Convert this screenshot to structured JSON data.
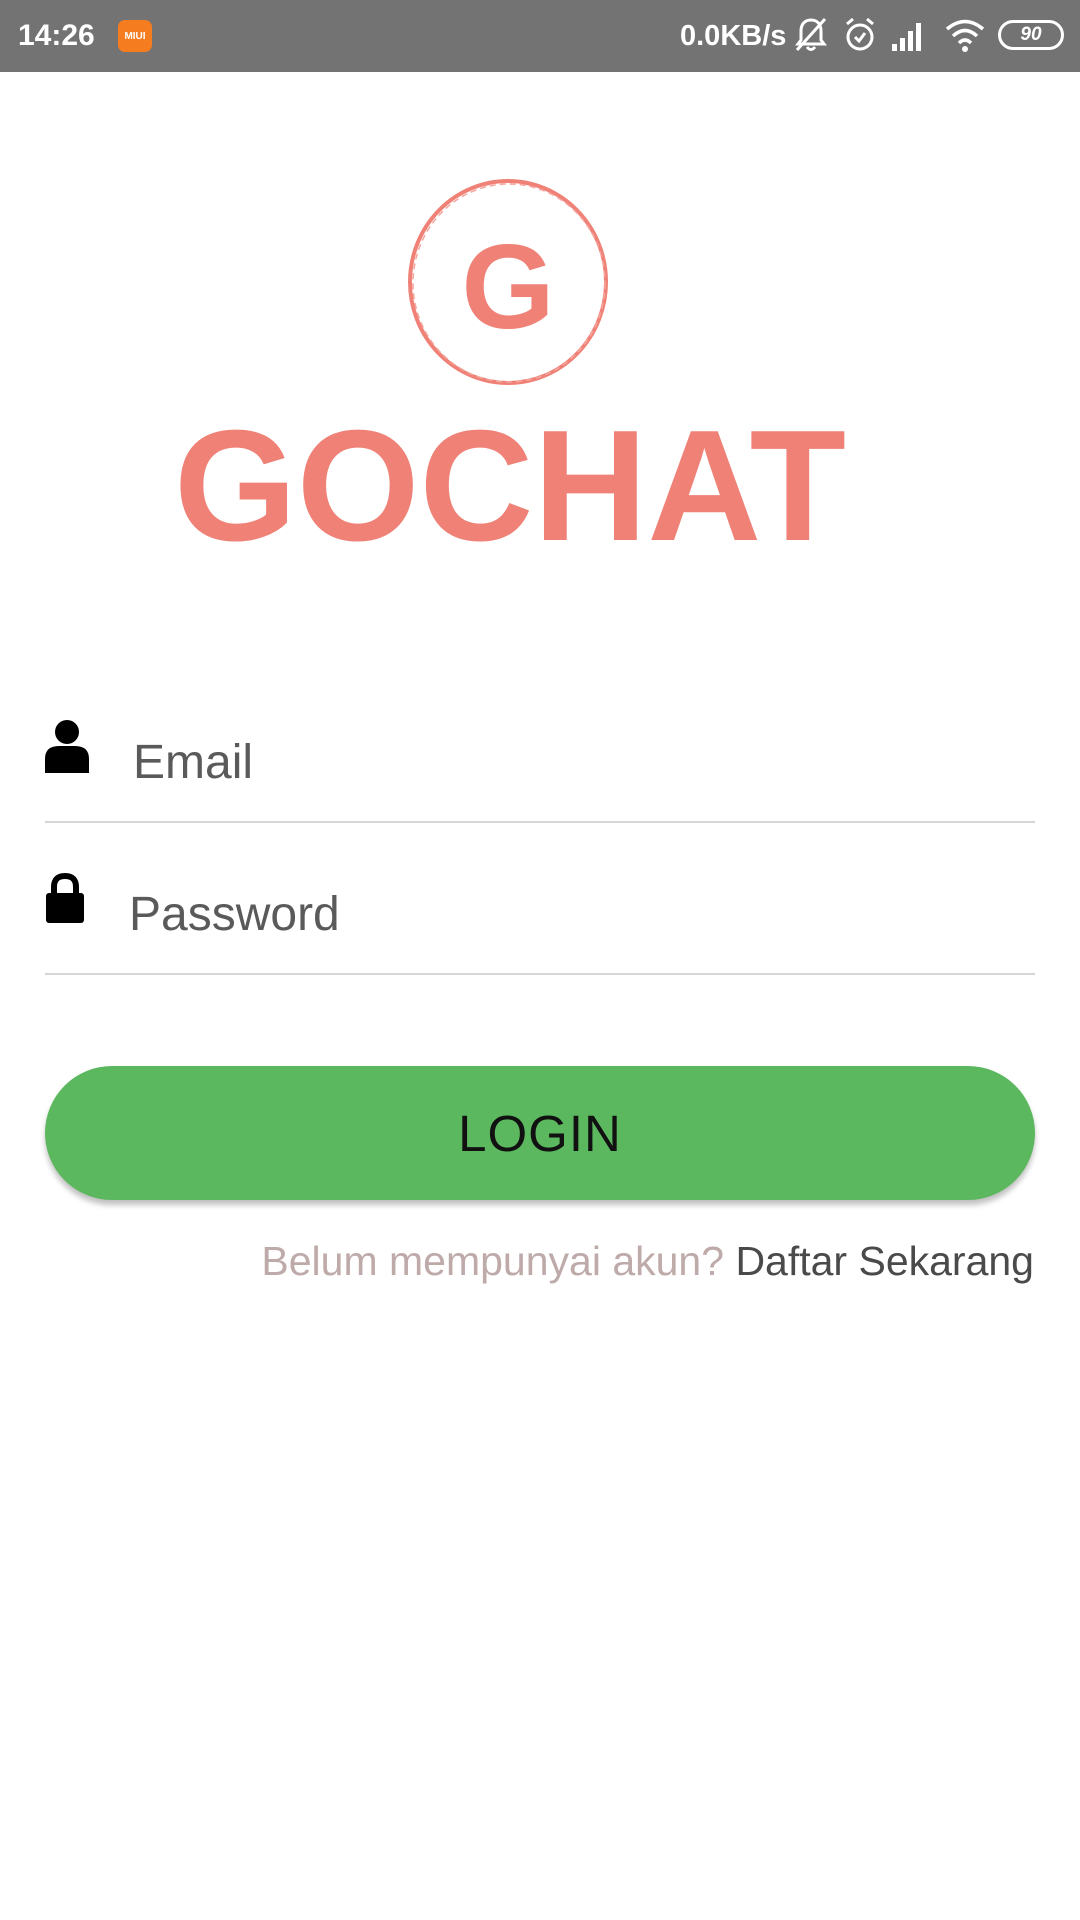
{
  "status_bar": {
    "time": "14:26",
    "miui_badge": "MIUI",
    "net_speed": "0.0KB/s",
    "battery_level": "90",
    "icons": [
      "miui-icon",
      "silent-bell-icon",
      "alarm-icon",
      "signal-icon",
      "wifi-icon",
      "battery-icon"
    ]
  },
  "logo": {
    "monogram": "G",
    "wordmark": "GOCHAT",
    "color": "#ef8176"
  },
  "form": {
    "email": {
      "placeholder": "Email",
      "value": "",
      "icon": "user-icon"
    },
    "password": {
      "placeholder": "Password",
      "value": "",
      "icon": "lock-icon"
    },
    "login_label": "LOGIN",
    "register_prompt": "Belum mempunyai akun?",
    "register_link": "Daftar Sekarang"
  },
  "colors": {
    "status_bar": "#737373",
    "accent_green": "#5cb85f",
    "logo_salmon": "#ef8176",
    "prompt_text": "#bfaaaa"
  }
}
